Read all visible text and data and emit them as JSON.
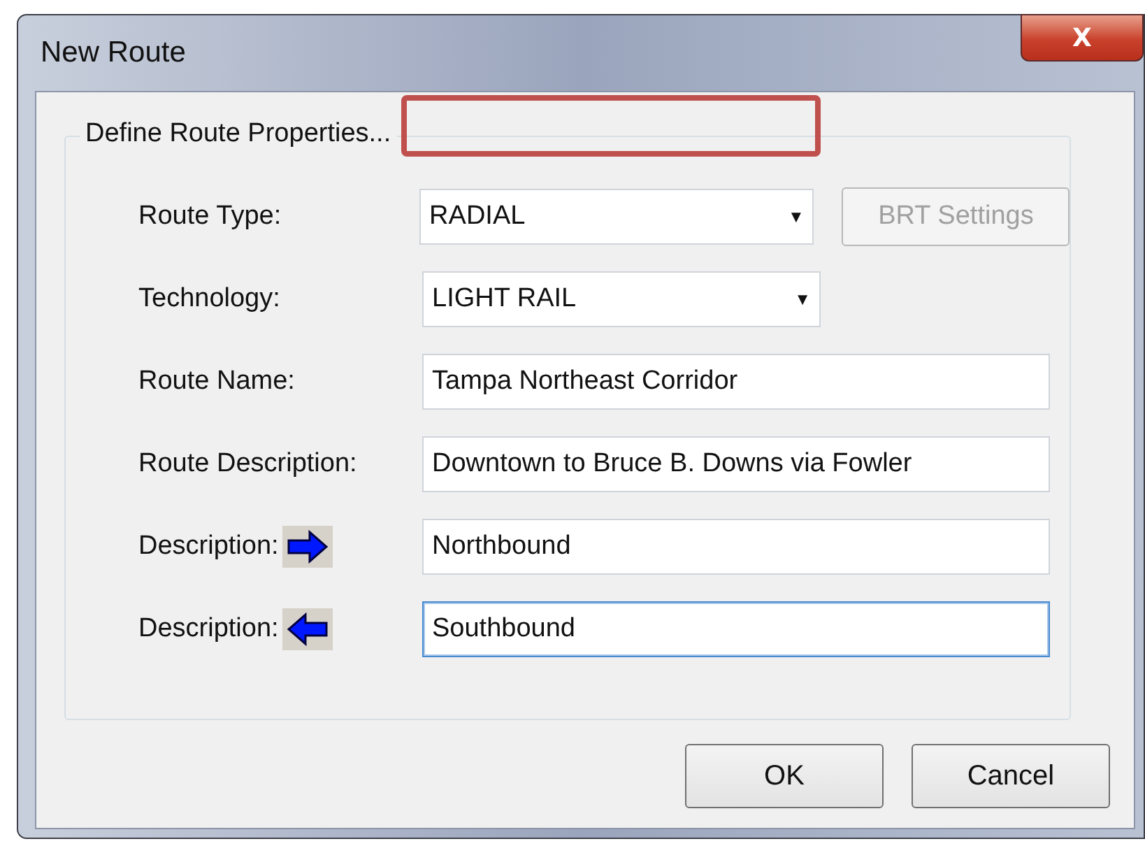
{
  "window": {
    "title": "New Route",
    "close": "X"
  },
  "group": {
    "title": "Define Route Properties..."
  },
  "fields": [
    {
      "label": "Route Type:",
      "kind": "dropdown",
      "value": "RADIAL",
      "caret": "▼"
    },
    {
      "label": "Technology:",
      "kind": "dropdown",
      "value": "LIGHT RAIL",
      "caret": "▼"
    },
    {
      "label": "Route Name:",
      "kind": "text",
      "value": "Tampa Northeast Corridor",
      "focused": false
    },
    {
      "label": "Route Description:",
      "kind": "text",
      "value": "Downtown to Bruce B. Downs via Fowler",
      "focused": false
    },
    {
      "label": "Description:",
      "kind": "text_right_arrow",
      "value": "Northbound",
      "focused": false
    },
    {
      "label": "Description:",
      "kind": "text_left_arrow",
      "value": "Southbound",
      "focused": true
    }
  ],
  "side_button": {
    "label": "BRT Settings",
    "disabled": true
  },
  "buttons": [
    "OK",
    "Cancel"
  ]
}
